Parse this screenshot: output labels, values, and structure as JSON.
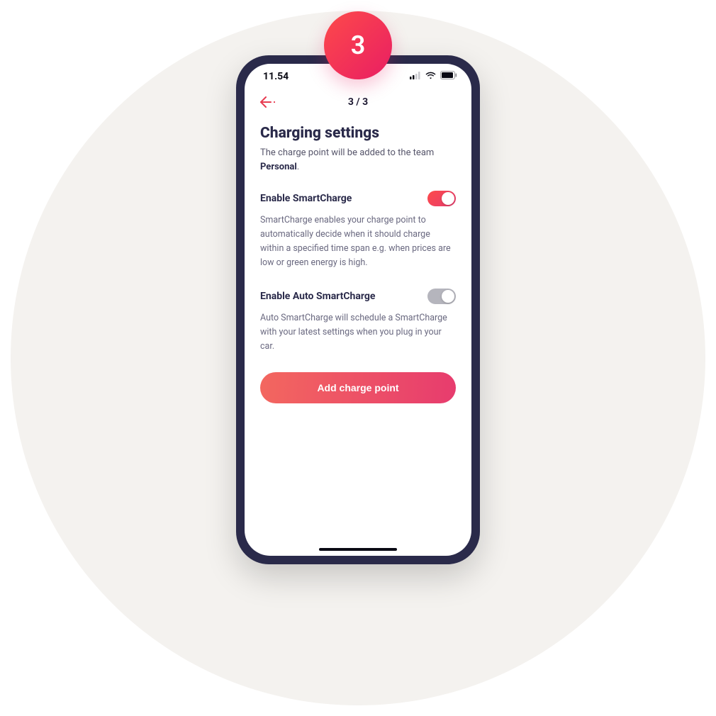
{
  "step_badge": "3",
  "statusbar": {
    "time": "11.54"
  },
  "nav": {
    "step_indicator": "3 / 3"
  },
  "page": {
    "title": "Charging settings",
    "subtext_prefix": "The charge point will be added to the team ",
    "subtext_team": "Personal",
    "subtext_suffix": "."
  },
  "settings": [
    {
      "label": "Enable SmartCharge",
      "description": "SmartCharge enables your charge point to automatically decide when it should charge within a specified time span e.g. when prices are low or green energy is high.",
      "enabled": true
    },
    {
      "label": "Enable Auto SmartCharge",
      "description": "Auto SmartCharge will schedule a SmartCharge with your latest settings when you plug in your car.",
      "enabled": false
    }
  ],
  "cta": {
    "label": "Add charge point"
  }
}
